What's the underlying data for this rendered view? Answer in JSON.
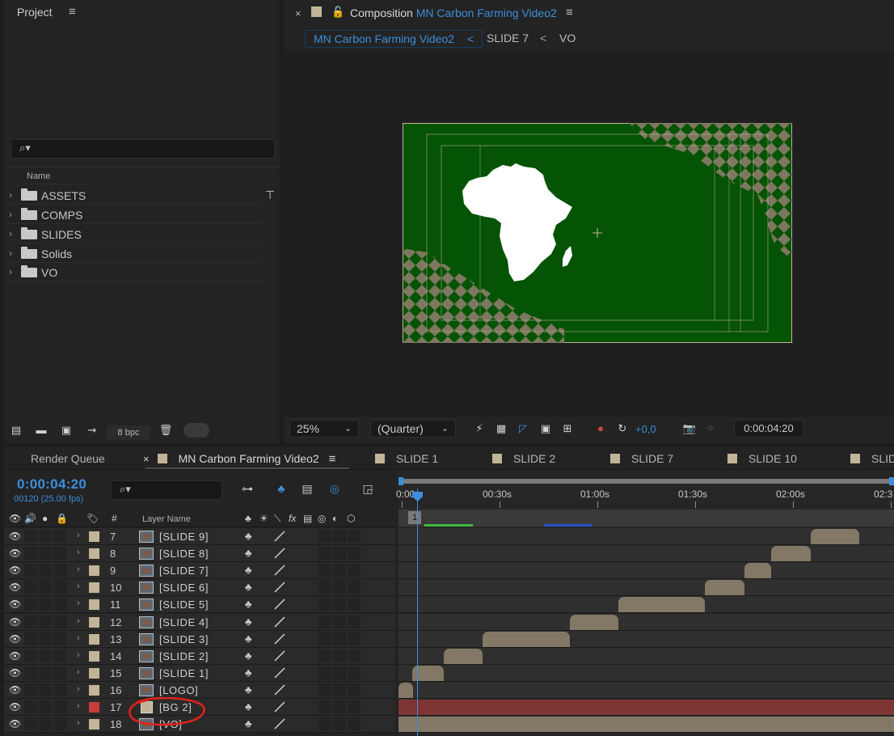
{
  "project": {
    "tab_title": "Project",
    "menu_glyph": "≡",
    "search_glyph": "⌕▾",
    "column_name": "Name",
    "items": [
      {
        "label": "ASSETS"
      },
      {
        "label": "COMPS"
      },
      {
        "label": "SLIDES"
      },
      {
        "label": "Solids"
      },
      {
        "label": "VO"
      }
    ],
    "bpc_label": "8 bpc",
    "footer_icons": [
      "interpret-footage-icon",
      "new-folder-icon",
      "new-composition-icon",
      "flowchart-settings-icon",
      "trash-icon"
    ]
  },
  "viewer": {
    "close_glyph": "×",
    "lock_glyph": "🔓",
    "title_prefix": "Composition",
    "comp_name": "MN Carbon Farming Video2",
    "menu_glyph": "≡",
    "breadcrumbs": {
      "active": "MN Carbon Farming Video2",
      "sep1": "<",
      "item2": "SLIDE 7",
      "sep2": "<",
      "item3": "VO"
    },
    "toolbar": {
      "zoom": "25%",
      "resolution": "(Quarter)",
      "exposure": "+0,0",
      "time": "0:00:04:20"
    },
    "colors": {
      "comp_bg": "#055305",
      "pattern": "#7e7860",
      "accent": "#3d8edc"
    }
  },
  "timeline": {
    "tabs": [
      {
        "label": "Render Queue"
      },
      {
        "label": "MN Carbon Farming Video2"
      },
      {
        "label": "SLIDE 1"
      },
      {
        "label": "SLIDE 2"
      },
      {
        "label": "SLIDE 7"
      },
      {
        "label": "SLIDE 10"
      },
      {
        "label": "SLID"
      }
    ],
    "close_glyph": "×",
    "menu_glyph": "≡",
    "timecode": "0:00:04:20",
    "frame_info": "00120 (25.00 fps)",
    "search_glyph": "⌕▾",
    "col_num": "#",
    "col_layer_name": "Layer Name",
    "ruler": {
      "labels": [
        "0:00s",
        "00:30s",
        "01:00s",
        "01:30s",
        "02:00s",
        "02:3"
      ],
      "marker": "1"
    },
    "layers": [
      {
        "num": "7",
        "name": "[SLIDE 9]",
        "type": "comp",
        "label_color": "#c2b497",
        "start": 0.832,
        "end": 0.93
      },
      {
        "num": "8",
        "name": "[SLIDE 8]",
        "type": "comp",
        "label_color": "#c2b497",
        "start": 0.752,
        "end": 0.832
      },
      {
        "num": "9",
        "name": "[SLIDE 7]",
        "type": "comp",
        "label_color": "#c2b497",
        "start": 0.698,
        "end": 0.752
      },
      {
        "num": "10",
        "name": "[SLIDE 6]",
        "type": "comp",
        "label_color": "#c2b497",
        "start": 0.618,
        "end": 0.698
      },
      {
        "num": "11",
        "name": "[SLIDE 5]",
        "type": "comp",
        "label_color": "#c2b497",
        "start": 0.444,
        "end": 0.618
      },
      {
        "num": "12",
        "name": "[SLIDE 4]",
        "type": "comp",
        "label_color": "#c2b497",
        "start": 0.346,
        "end": 0.444
      },
      {
        "num": "13",
        "name": "[SLIDE 3]",
        "type": "comp",
        "label_color": "#c2b497",
        "start": 0.17,
        "end": 0.346
      },
      {
        "num": "14",
        "name": "[SLIDE 2]",
        "type": "comp",
        "label_color": "#c2b497",
        "start": 0.092,
        "end": 0.17
      },
      {
        "num": "15",
        "name": "[SLIDE 1]",
        "type": "comp",
        "label_color": "#c2b497",
        "start": 0.028,
        "end": 0.092
      },
      {
        "num": "16",
        "name": "[LOGO]",
        "type": "comp",
        "label_color": "#c2b497",
        "start": 0.0,
        "end": 0.03
      },
      {
        "num": "17",
        "name": "[BG 2]",
        "type": "solid",
        "label_color": "#c83c3c",
        "start": 0.0,
        "end": 1.0,
        "bar_color": "#7f3434"
      },
      {
        "num": "18",
        "name": "[VO]",
        "type": "comp",
        "label_color": "#c2b497",
        "start": 0.0,
        "end": 1.0
      }
    ]
  }
}
